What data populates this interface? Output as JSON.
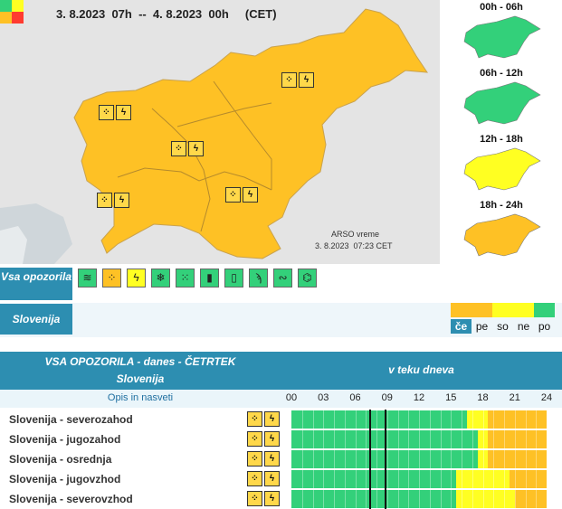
{
  "map": {
    "period": "3. 8.2023  07h  --  4. 8.2023  00h",
    "timezone": "(CET)",
    "source": "ARSO vreme",
    "timestamp": "3. 8.2023  07:23 CET",
    "level_colors": {
      "green": "#33d07a",
      "yellow": "#ffff22",
      "orange": "#fec125",
      "red": "#ff3b30"
    }
  },
  "intervals": [
    {
      "label": "00h - 06h",
      "color": "#33d07a"
    },
    {
      "label": "06h - 12h",
      "color": "#33d07a"
    },
    {
      "label": "12h - 18h",
      "color": "#ffff22"
    },
    {
      "label": "18h - 24h",
      "color": "#fec125"
    }
  ],
  "filter_bar": {
    "all_label": "Vsa opozorila",
    "icons": [
      {
        "name": "wind-icon",
        "glyph": "≋"
      },
      {
        "name": "rain-icon",
        "glyph": "⁘"
      },
      {
        "name": "thunderstorm-icon",
        "glyph": "ϟ"
      },
      {
        "name": "snow-icon",
        "glyph": "❄"
      },
      {
        "name": "snow-rain-icon",
        "glyph": "⁙"
      },
      {
        "name": "high-temperature-icon",
        "glyph": "▮"
      },
      {
        "name": "low-temperature-icon",
        "glyph": "▯"
      },
      {
        "name": "fire-icon",
        "glyph": "ϡ"
      },
      {
        "name": "fog-icon",
        "glyph": "∾"
      },
      {
        "name": "ice-icon",
        "glyph": "⌬"
      }
    ],
    "active_index": 1
  },
  "slovenia_row": {
    "label": "Slovenija",
    "days": [
      "če",
      "pe",
      "so",
      "ne",
      "po"
    ],
    "day_colors": [
      "#fec125",
      "#fec125",
      "#ffff22",
      "#ffff22",
      "#33d07a"
    ],
    "selected_day": 0
  },
  "table": {
    "title": "VSA OPOZORILA - danes - ČETRTEK",
    "region": "Slovenija",
    "during_day": "v teku dneva",
    "desc_link": "Opis in nasveti",
    "hours": [
      "00",
      "03",
      "06",
      "09",
      "12",
      "15",
      "18",
      "21",
      "24"
    ],
    "rows": [
      {
        "name": "Slovenija - severozahod",
        "timeline": [
          {
            "from": 0,
            "to": 16.5,
            "level": "green"
          },
          {
            "from": 16.5,
            "to": 18.5,
            "level": "yellow"
          },
          {
            "from": 18.5,
            "to": 24,
            "level": "orange"
          }
        ]
      },
      {
        "name": "Slovenija - jugozahod",
        "timeline": [
          {
            "from": 0,
            "to": 17.5,
            "level": "green"
          },
          {
            "from": 17.5,
            "to": 18.5,
            "level": "yellow"
          },
          {
            "from": 18.5,
            "to": 24,
            "level": "orange"
          }
        ]
      },
      {
        "name": "Slovenija - osrednja",
        "timeline": [
          {
            "from": 0,
            "to": 17.5,
            "level": "green"
          },
          {
            "from": 17.5,
            "to": 18.5,
            "level": "yellow"
          },
          {
            "from": 18.5,
            "to": 24,
            "level": "orange"
          }
        ]
      },
      {
        "name": "Slovenija - jugovzhod",
        "timeline": [
          {
            "from": 0,
            "to": 15.5,
            "level": "green"
          },
          {
            "from": 15.5,
            "to": 20.5,
            "level": "yellow"
          },
          {
            "from": 20.5,
            "to": 24,
            "level": "orange"
          }
        ]
      },
      {
        "name": "Slovenija - severovzhod",
        "timeline": [
          {
            "from": 0,
            "to": 15.5,
            "level": "green"
          },
          {
            "from": 15.5,
            "to": 21,
            "level": "yellow"
          },
          {
            "from": 21,
            "to": 24,
            "level": "orange"
          }
        ]
      }
    ],
    "current_time_markers": [
      7.3,
      8.8
    ]
  }
}
